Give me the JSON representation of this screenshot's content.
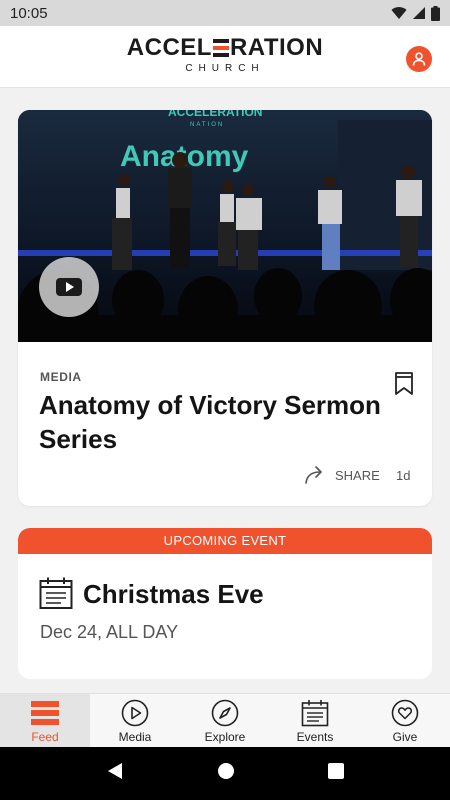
{
  "status_bar": {
    "time": "10:05"
  },
  "header": {
    "logo_main_before": "ACCEL",
    "logo_main_after": "RATION",
    "logo_sub": "CHURCH"
  },
  "media_card": {
    "image_overlay_brand": "ACCELERATION",
    "image_overlay_sub": "NATION",
    "image_overlay_title": "Anatomy",
    "label": "MEDIA",
    "title": "Anatomy of Victory Sermon Series",
    "share_label": "SHARE",
    "age": "1d"
  },
  "event_card": {
    "banner": "UPCOMING EVENT",
    "title": "Christmas Eve",
    "date": "Dec 24, ALL DAY"
  },
  "bottom_nav": {
    "items": [
      {
        "label": "Feed",
        "icon": "feed-icon",
        "active": true
      },
      {
        "label": "Media",
        "icon": "play-circle-icon",
        "active": false
      },
      {
        "label": "Explore",
        "icon": "compass-icon",
        "active": false
      },
      {
        "label": "Events",
        "icon": "calendar-icon",
        "active": false
      },
      {
        "label": "Give",
        "icon": "heart-icon",
        "active": false
      }
    ]
  },
  "colors": {
    "accent": "#f0522d",
    "stage_teal": "#3fc9b6",
    "stage_blue": "#2a48d8"
  }
}
